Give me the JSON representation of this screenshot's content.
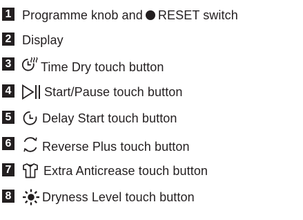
{
  "items": [
    {
      "number": "1",
      "text": "Programme knob and",
      "extra_text": "RESET switch",
      "icon": "filled-circle-icon"
    },
    {
      "number": "2",
      "text": "Display"
    },
    {
      "number": "3",
      "text": "Time Dry touch button",
      "icon": "clock-steam-icon"
    },
    {
      "number": "4",
      "text": "Start/Pause touch button",
      "icon": "play-pause-icon"
    },
    {
      "number": "5",
      "text": "Delay Start touch button",
      "icon": "clock-icon"
    },
    {
      "number": "6",
      "text": "Reverse Plus touch button",
      "icon": "reverse-arrows-icon"
    },
    {
      "number": "7",
      "text": "Extra Anticrease touch button",
      "icon": "shirt-icon"
    },
    {
      "number": "8",
      "text": "Dryness Level touch button",
      "icon": "sun-dryness-icon"
    }
  ],
  "colors": {
    "text": "#231f20",
    "badge_bg": "#231f20",
    "badge_text": "#ffffff"
  }
}
